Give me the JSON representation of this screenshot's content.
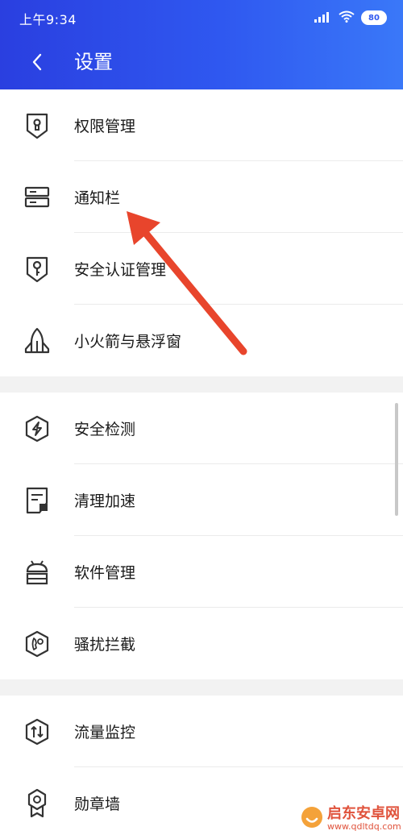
{
  "status_bar": {
    "time": "上午9:34",
    "battery": "80"
  },
  "header": {
    "title": "设置",
    "back_icon": "chevron-left-icon"
  },
  "groups": [
    {
      "items": [
        {
          "label": "权限管理",
          "icon": "shield-keyhole-icon"
        },
        {
          "label": "通知栏",
          "icon": "notification-bar-icon"
        },
        {
          "label": "安全认证管理",
          "icon": "shield-key-icon"
        },
        {
          "label": "小火箭与悬浮窗",
          "icon": "rocket-icon"
        }
      ]
    },
    {
      "items": [
        {
          "label": "安全检测",
          "icon": "shield-lightning-icon"
        },
        {
          "label": "清理加速",
          "icon": "clean-document-icon"
        },
        {
          "label": "软件管理",
          "icon": "android-icon"
        },
        {
          "label": "骚扰拦截",
          "icon": "phone-block-icon"
        }
      ]
    },
    {
      "items": [
        {
          "label": "流量监控",
          "icon": "data-traffic-icon"
        },
        {
          "label": "勋章墙",
          "icon": "medal-icon"
        }
      ]
    }
  ],
  "watermark": {
    "name": "启东安卓网",
    "url": "www.qdltdq.com"
  },
  "colors": {
    "header_start": "#2a3fe0",
    "header_end": "#3a78f8",
    "arrow": "#e8452c",
    "divider": "#ebebeb",
    "group_gap": "#f2f2f2"
  }
}
